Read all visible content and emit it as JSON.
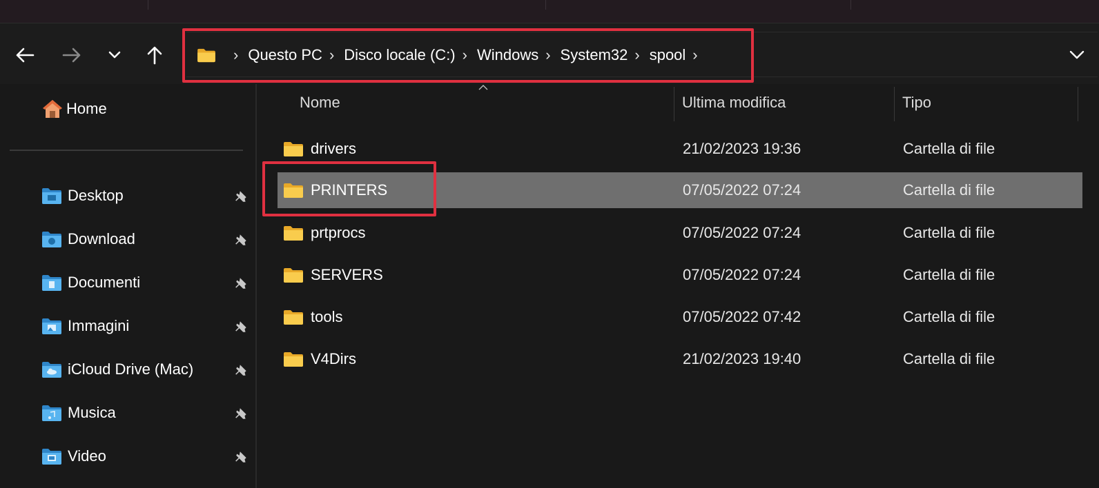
{
  "navigation": {
    "back_icon": "arrow-left-icon",
    "forward_icon": "arrow-right-icon",
    "recent_icon": "chevron-down-icon",
    "up_icon": "arrow-up-icon"
  },
  "address_bar": {
    "crumbs": [
      "Questo PC",
      "Disco locale (C:)",
      "Windows",
      "System32",
      "spool"
    ],
    "highlight_color": "#e03040"
  },
  "sidebar": {
    "home": "Home",
    "items": [
      {
        "label": "Desktop",
        "icon": "desktop-folder-icon"
      },
      {
        "label": "Download",
        "icon": "download-folder-icon"
      },
      {
        "label": "Documenti",
        "icon": "documents-folder-icon"
      },
      {
        "label": "Immagini",
        "icon": "pictures-folder-icon"
      },
      {
        "label": "iCloud Drive (Mac)",
        "icon": "cloud-folder-icon"
      },
      {
        "label": "Musica",
        "icon": "music-folder-icon"
      },
      {
        "label": "Video",
        "icon": "video-folder-icon"
      }
    ]
  },
  "columns": {
    "name": "Nome",
    "modified": "Ultima modifica",
    "type": "Tipo"
  },
  "files": [
    {
      "name": "drivers",
      "modified": "21/02/2023 19:36",
      "type": "Cartella di file",
      "selected": false
    },
    {
      "name": "PRINTERS",
      "modified": "07/05/2022 07:24",
      "type": "Cartella di file",
      "selected": true
    },
    {
      "name": "prtprocs",
      "modified": "07/05/2022 07:24",
      "type": "Cartella di file",
      "selected": false
    },
    {
      "name": "SERVERS",
      "modified": "07/05/2022 07:24",
      "type": "Cartella di file",
      "selected": false
    },
    {
      "name": "tools",
      "modified": "07/05/2022 07:42",
      "type": "Cartella di file",
      "selected": false
    },
    {
      "name": "V4Dirs",
      "modified": "21/02/2023 19:40",
      "type": "Cartella di file",
      "selected": false
    }
  ],
  "colors": {
    "folder": "#f4c542",
    "selection": "#6f6f6f",
    "sidebar_icon": "#4fa8e8"
  }
}
